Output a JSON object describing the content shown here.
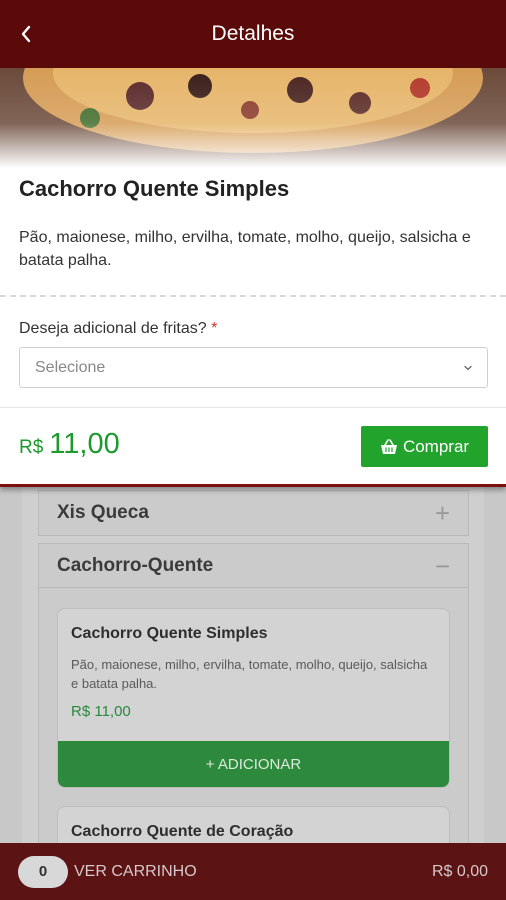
{
  "header": {
    "title": "Detalhes",
    "back_icon": "chevron-left-icon"
  },
  "product": {
    "title": "Cachorro Quente Simples",
    "description": "Pão, maionese, milho, ervilha, tomate, molho, queijo, salsicha e batata palha.",
    "option_question": "Deseja adicional de fritas?",
    "required_mark": "*",
    "select_placeholder": "Selecione",
    "price_currency": "R$",
    "price_value": "11,00",
    "buy_label": "Comprar",
    "buy_icon": "basket-icon"
  },
  "menu": {
    "categories": [
      {
        "name": "Xis Queca",
        "sign": "+"
      },
      {
        "name": "Cachorro-Quente",
        "sign": "−"
      }
    ],
    "items": [
      {
        "title": "Cachorro Quente Simples",
        "description": "Pão, maionese, milho, ervilha, tomate, molho, queijo, salsicha e batata palha.",
        "price": "R$ 11,00",
        "button": "+ ADICIONAR"
      },
      {
        "title": "Cachorro Quente de Coração"
      }
    ]
  },
  "cart": {
    "count": "0",
    "label": "VER CARRINHO",
    "total": "R$ 0,00"
  },
  "colors": {
    "brand": "#5b0a0a",
    "accent_green": "#21a32c",
    "price_green": "#1c9a2e"
  }
}
